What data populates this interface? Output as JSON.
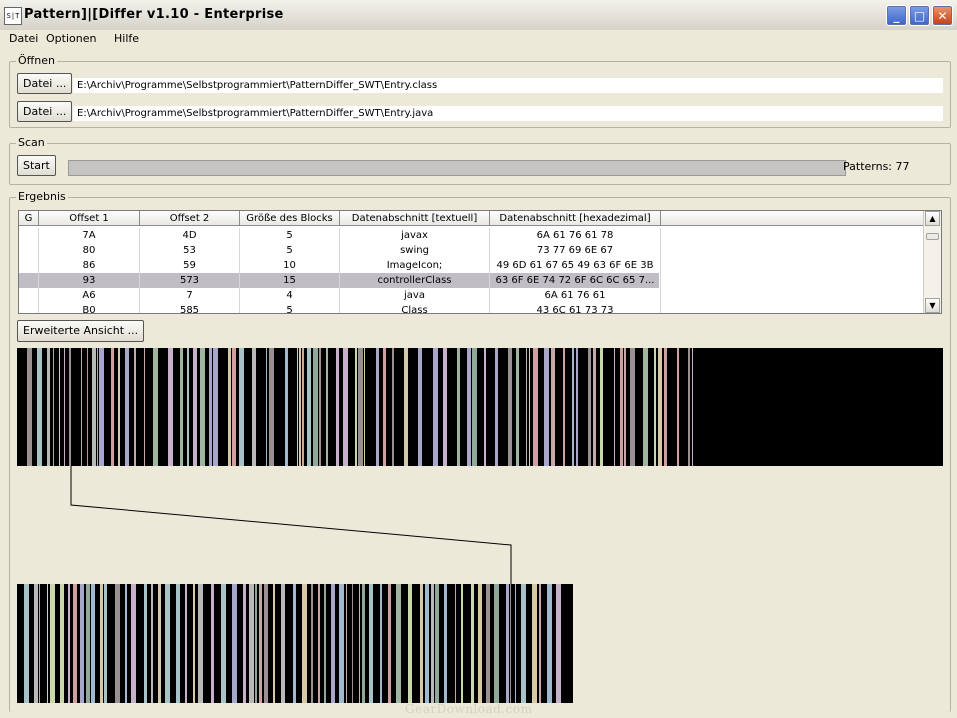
{
  "window": {
    "icon_text": "S|T",
    "title": "Pattern]|[Differ v1.10 - Enterprise",
    "controls": {
      "minimize": "_",
      "maximize": "□",
      "close": "✕"
    }
  },
  "menu": {
    "items": [
      "Datei",
      "Optionen",
      "Hilfe"
    ]
  },
  "open_group": {
    "legend": "Öffnen",
    "rows": [
      {
        "button": "Datei ...",
        "path": "E:\\Archiv\\Programme\\Selbstprogrammiert\\PatternDiffer_SWT\\Entry.class"
      },
      {
        "button": "Datei ...",
        "path": "E:\\Archiv\\Programme\\Selbstprogrammiert\\PatternDiffer_SWT\\Entry.java"
      }
    ]
  },
  "scan_group": {
    "legend": "Scan",
    "start_label": "Start",
    "progress": 0,
    "patterns_label": "Patterns: 77"
  },
  "result_group": {
    "legend": "Ergebnis",
    "columns": [
      "G",
      "Offset 1",
      "Offset 2",
      "Größe des Blocks",
      "Datenabschnitt [textuell]",
      "Datenabschnitt [hexadezimal]"
    ],
    "rows": [
      [
        "",
        "7A",
        "4D",
        "5",
        "javax",
        "6A 61 76 61 78"
      ],
      [
        "",
        "80",
        "53",
        "5",
        "swing",
        "73 77 69 6E 67"
      ],
      [
        "",
        "86",
        "59",
        "10",
        "ImageIcon;",
        "49 6D 61 67 65 49 63 6F 6E 3B"
      ],
      [
        "",
        "93",
        "573",
        "15",
        "controllerClass",
        "63 6F 6E 74 72 6F 6C 6C 65 7..."
      ],
      [
        "",
        "A6",
        "7",
        "4",
        "java",
        "6A 61 76 61"
      ],
      [
        "",
        "B0",
        "585",
        "5",
        "Class",
        "43 6C 61 73 73"
      ]
    ],
    "selected_row": 3,
    "extended_button": "Erweiterte Ansicht ..."
  },
  "colors": {
    "accent_title_blue": "#3c62c9",
    "close_red": "#c43e12",
    "strip_background": "#000000",
    "connector_line": "#000000"
  },
  "watermark": "GearDownload.com"
}
